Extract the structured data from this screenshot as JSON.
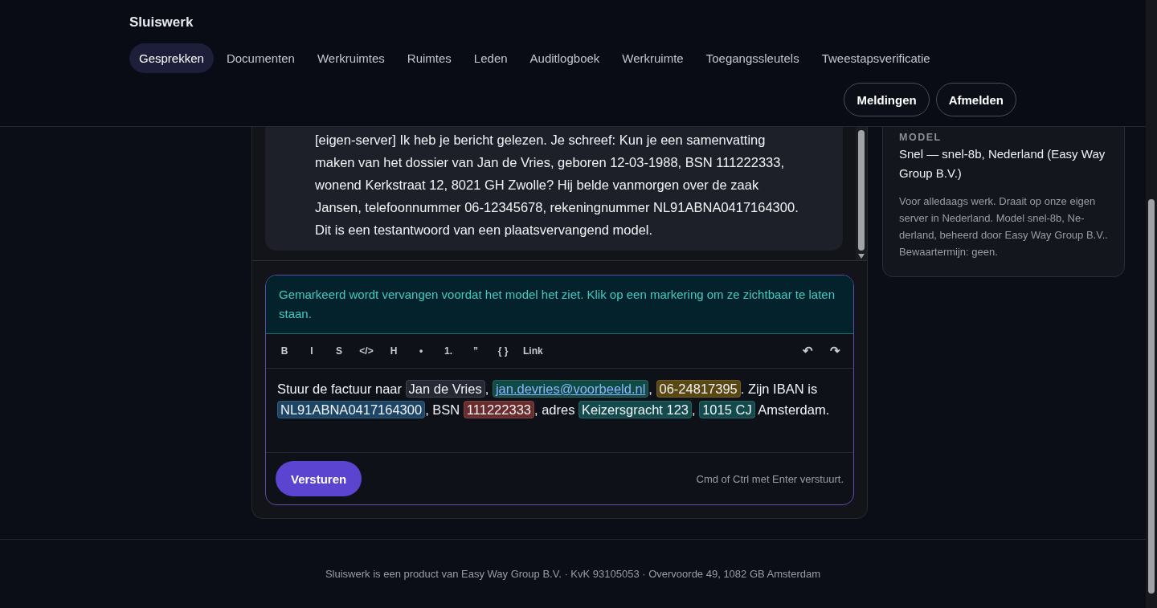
{
  "app": {
    "title": "Sluiswerk"
  },
  "tabs": [
    {
      "label": "Gesprekken",
      "selected": true
    },
    {
      "label": "Documenten",
      "selected": false
    },
    {
      "label": "Werkruimtes",
      "selected": false
    },
    {
      "label": "Ruimtes",
      "selected": false
    },
    {
      "label": "Leden",
      "selected": false
    },
    {
      "label": "Auditlogboek",
      "selected": false
    },
    {
      "label": "Werkruimte",
      "selected": false
    },
    {
      "label": "Toegangssleutels",
      "selected": false
    },
    {
      "label": "Tweestapsverificatie",
      "selected": false
    }
  ],
  "header_buttons": [
    "Meldingen",
    "Afmelden"
  ],
  "message": {
    "lines": [
      "[eigen-server] Ik heb je bericht gelezen. Je schreef: Kun je een samenvatting",
      "maken van het dossier van Jan de Vries, geboren 12-03-1988, BSN 111222333,",
      "wonend Kerkstraat 12, 8021 GH Zwolle? Hij belde vanmorgen over de zaak",
      "Jansen, telefoonnummer 06-12345678, rekeningnummer NL91ABNA0417164300.",
      "Dit is een testantwoord van een plaatsvervangend model."
    ]
  },
  "composer": {
    "notice": "Gemarkeerd wordt vervangen voordat het model het ziet. Klik op een markering om ze zichtbaar te laten staan.",
    "toolbar": [
      "B",
      "I",
      "S",
      "</>",
      "H",
      "•",
      "1.",
      "”",
      "{ }",
      "Link"
    ],
    "history": [
      "↶",
      "↷"
    ],
    "segments": [
      {
        "kind": "text",
        "text": "Stuur de factuur naar "
      },
      {
        "kind": "mark",
        "text": "Jan de Vries",
        "color": "#262833"
      },
      {
        "kind": "text",
        "text": ", "
      },
      {
        "kind": "mark",
        "text": "jan.devries@voorbeeld.nl",
        "color": "#0f4a44"
      },
      {
        "kind": "text",
        "text": ", "
      },
      {
        "kind": "mark",
        "text": "06-24817395",
        "color": "#5a4712"
      },
      {
        "kind": "text",
        "text": ". Zijn IBAN is "
      },
      {
        "kind": "mark",
        "text": "NL91ABNA0417164300",
        "color": "#1d4566"
      },
      {
        "kind": "text",
        "text": ", BSN "
      },
      {
        "kind": "mark",
        "text": "111222333",
        "color": "#6a2c2c"
      },
      {
        "kind": "text",
        "text": ", adres "
      },
      {
        "kind": "mark",
        "text": "Keizersgracht 123",
        "color": "#134a4c"
      },
      {
        "kind": "text",
        "text": ", "
      },
      {
        "kind": "mark",
        "text": "1015 CJ",
        "color": "#134a4c"
      },
      {
        "kind": "text",
        "text": " Amsterdam."
      }
    ],
    "send_button": "Versturen",
    "hint": "Cmd of Ctrl met Enter verstuurt."
  },
  "model_card": {
    "label": "MODEL",
    "name": "Snel — snel-8b, Nederland (Easy Way Group B.V.)",
    "description": "Voor alledaags werk. Draait op onze eigen server in Nederland. Model snel-8b, Ne-derland, beheerd door Easy Way Group B.V.. Bewaartermijn: geen."
  },
  "footer": "Sluiswerk is een product van Easy Way Group B.V. · KvK 93105053 · Overvoorde 49, 1082 GB Amsterdam"
}
